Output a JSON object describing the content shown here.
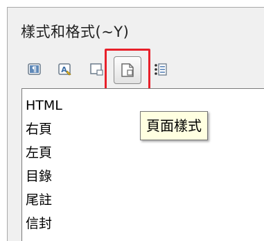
{
  "panel": {
    "title": "樣式和格式(~Y)"
  },
  "toolbar": {
    "buttons": [
      {
        "name": "paragraph-styles",
        "icon": "paragraph-styles-icon",
        "active": false
      },
      {
        "name": "character-styles",
        "icon": "character-styles-icon",
        "active": false
      },
      {
        "name": "frame-styles",
        "icon": "frame-styles-icon",
        "active": false
      },
      {
        "name": "page-styles",
        "icon": "page-styles-icon",
        "active": true
      },
      {
        "name": "list-styles",
        "icon": "list-styles-icon",
        "active": false
      }
    ],
    "tooltip": "頁面樣式",
    "highlight_color": "#e8202a"
  },
  "list": {
    "items": [
      "HTML",
      "右頁",
      "左頁",
      "目錄",
      "尾註",
      "信封"
    ]
  }
}
